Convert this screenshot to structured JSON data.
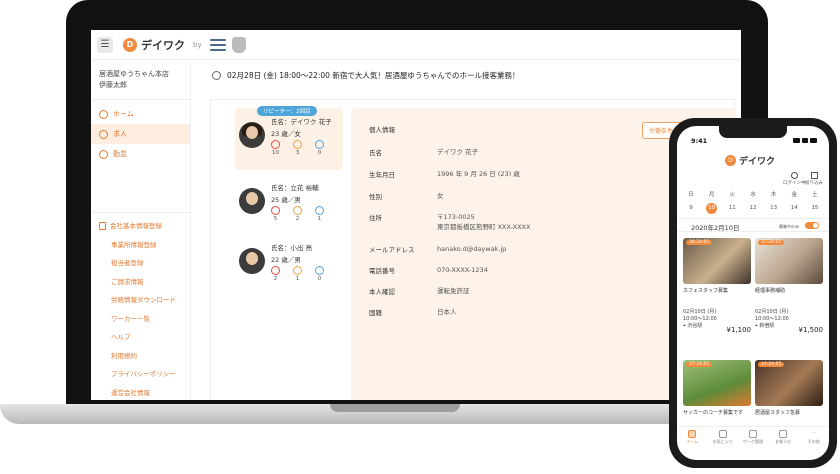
{
  "desktop": {
    "logo": "デイワク",
    "logo_initial": "D",
    "by_text": "by",
    "store_name": "居酒屋ゆうちゃん本店",
    "user_name": "伊藤太郎",
    "nav": [
      {
        "label": "ホーム",
        "icon": "home-icon"
      },
      {
        "label": "求人",
        "icon": "search-icon"
      },
      {
        "label": "勤怠",
        "icon": "clock-icon"
      }
    ],
    "submenu": [
      "会社基本情報登録",
      "事業所情報登録",
      "担当者登録",
      "ご請求情報",
      "労務情報ダウンロード",
      "ワーカー一覧",
      "ヘルプ",
      "利用規約",
      "プライバシーポリシー",
      "運営会社情報"
    ],
    "job_title": "02月28日 (金) 18:00～22:00 新宿で大人気！居酒屋ゆうちゃんでのホール接客業務！",
    "applicants": [
      {
        "badge": "リピーター：2回目",
        "name": "氏名：デイワク 花子",
        "age": "23 歳／女",
        "good": "10",
        "neutral": "3",
        "bad": "0"
      },
      {
        "badge": "",
        "name": "氏名：立花 裕輔",
        "age": "25 歳／男",
        "good": "5",
        "neutral": "2",
        "bad": "1"
      },
      {
        "badge": "",
        "name": "氏名：小出 亮",
        "age": "22 歳／男",
        "good": "2",
        "neutral": "1",
        "bad": "0"
      }
    ],
    "detail": {
      "section_title": "個人情報",
      "download_button": "労働条件通知書をダウンロード",
      "name_label": "氏名",
      "name": "デイワク 花子",
      "dob_label": "生年月日",
      "dob": "1996 年 9 月 26 日 (23) 歳",
      "gender_label": "性別",
      "gender": "女",
      "address_label": "住所",
      "postal": "〒173-0025",
      "address": "東京都板橋区熊野町 XXX-XXXX",
      "email_label": "メールアドレス",
      "email": "hanako.d@daywak.jp",
      "phone_label": "電話番号",
      "phone": "070-XXXX-1234",
      "id_label": "本人確認",
      "id_value": "運転免許証",
      "nationality_label": "国籍",
      "nationality": "日本人"
    }
  },
  "mobile": {
    "time": "9:41",
    "logo": "デイワク",
    "logo_initial": "D",
    "login": "ログイン中",
    "filter": "絞り込み",
    "week": [
      {
        "day": "日",
        "num": "9",
        "selected": false
      },
      {
        "day": "月",
        "num": "10",
        "selected": true
      },
      {
        "day": "火",
        "num": "11",
        "selected": false
      },
      {
        "day": "水",
        "num": "12",
        "selected": false
      },
      {
        "day": "木",
        "num": "13",
        "selected": false
      },
      {
        "day": "金",
        "num": "14",
        "selected": false
      },
      {
        "day": "土",
        "num": "15",
        "selected": false
      }
    ],
    "date": "2020年2月10日",
    "recruiting": "募集中のみ",
    "jobs": [
      {
        "time": "36:24:05",
        "title": "カフェスタッフ募集",
        "date": "02月10日 (月)",
        "hours": "10:00～12:00",
        "station": "渋谷駅",
        "pay": "¥1,100"
      },
      {
        "time": "37:24:05",
        "title": "経理事務補助",
        "date": "02月10日 (月)",
        "hours": "10:00～12:00",
        "station": "新宿駅",
        "pay": "¥1,500"
      },
      {
        "time": "37:24:05",
        "title": "サッカーのコーチ募集です",
        "date": "",
        "hours": "",
        "station": "",
        "pay": ""
      },
      {
        "time": "37:24:05",
        "title": "居酒屋スタッフ急募",
        "date": "",
        "hours": "",
        "station": "",
        "pay": ""
      }
    ],
    "tabs": [
      "ホーム",
      "お気に入り",
      "ワーク管理",
      "お知らせ",
      "その他"
    ]
  }
}
